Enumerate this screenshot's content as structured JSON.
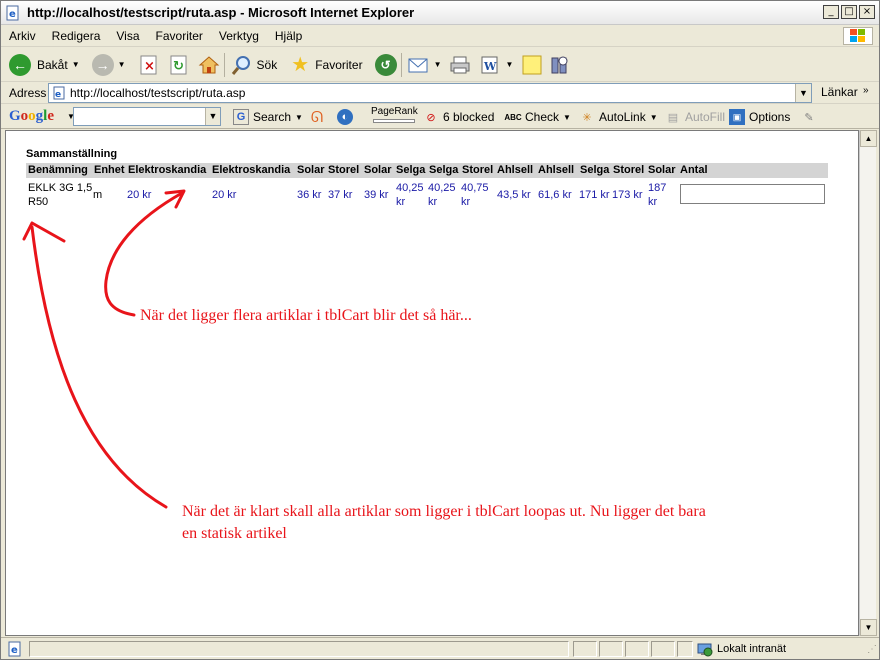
{
  "window": {
    "title": "http://localhost/testscript/ruta.asp - Microsoft Internet Explorer",
    "icon": "ie-page-icon"
  },
  "menu": [
    "Arkiv",
    "Redigera",
    "Visa",
    "Favoriter",
    "Verktyg",
    "Hjälp"
  ],
  "toolbar": {
    "back_label": "Bakåt",
    "search_label": "Sök",
    "favorites_label": "Favoriter"
  },
  "address": {
    "label": "Adress",
    "url": "http://localhost/testscript/ruta.asp",
    "links_label": "Länkar"
  },
  "google": {
    "logo": "Google",
    "search_label": "Search",
    "pagerank_label": "PageRank",
    "blocked_label": "6 blocked",
    "check_label": "Check",
    "autolink_label": "AutoLink",
    "autofill_label": "AutoFill",
    "options_label": "Options"
  },
  "page": {
    "heading": "Sammanställning",
    "columns": [
      "Benämning",
      "Enhet",
      "Elektroskandia",
      "Elektroskandia",
      "Solar",
      "Storel",
      "Solar",
      "Selga",
      "Selga",
      "Storel",
      "Ahlsell",
      "Ahlsell",
      "Selga",
      "Storel",
      "Solar",
      "Antal"
    ],
    "row": {
      "name_line1": "EKLK 3G 1,5",
      "name_line2": "R50",
      "unit": "m",
      "prices": [
        "20 kr",
        "20 kr",
        "36 kr",
        "37 kr",
        "39 kr",
        "40,25",
        "kr",
        "40,25",
        "kr",
        "40,75",
        "kr",
        "43,5 kr",
        "61,6 kr",
        "171 kr",
        "173 kr",
        "187",
        "kr"
      ]
    },
    "annotation1": "När det ligger flera artiklar i tblCart blir det så här...",
    "annotation2_line1": "När det är klart skall alla artiklar som ligger i tblCart loopas ut. Nu ligger det bara",
    "annotation2_line2": "en statisk artikel",
    "annotation_color": "#e8141a"
  },
  "status": {
    "zone": "Lokalt intranät"
  }
}
